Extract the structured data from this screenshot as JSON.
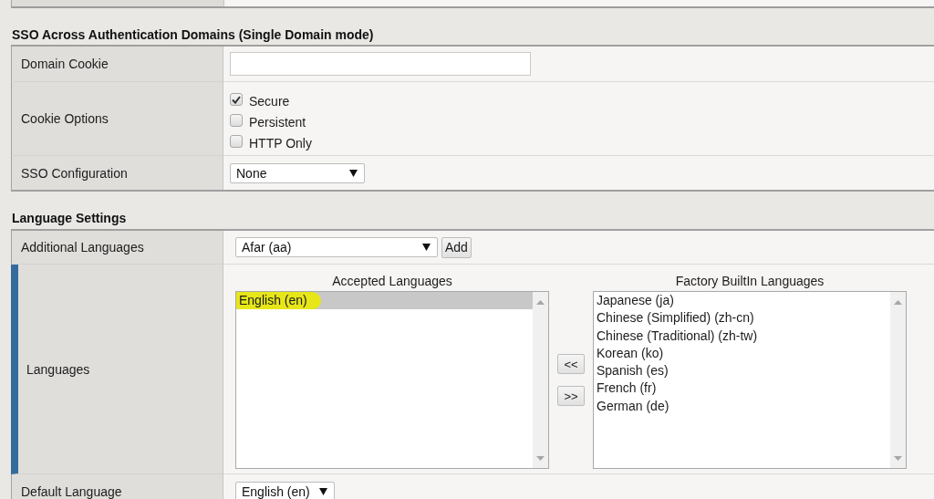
{
  "sections": [
    {
      "title": "SSO Across Authentication Domains (Single Domain mode)",
      "rows": [
        {
          "kind": "input",
          "label": "Domain Cookie",
          "active": false
        },
        {
          "kind": "checkboxes",
          "label": "Cookie Options",
          "active": false,
          "options": [
            {
              "label": "Secure",
              "checked": true
            },
            {
              "label": "Persistent",
              "checked": false
            },
            {
              "label": "HTTP Only",
              "checked": false
            }
          ]
        },
        {
          "kind": "select",
          "label": "SSO Configuration",
          "active": false,
          "value": "None"
        }
      ]
    },
    {
      "title": "Language Settings",
      "rows": [
        {
          "kind": "select_add",
          "label": "Additional Languages",
          "active": false,
          "value": "Afar (aa)",
          "button": "Add"
        },
        {
          "kind": "lists",
          "label": "Languages",
          "active": true,
          "accepted": {
            "title": "Accepted Languages",
            "items": [
              {
                "label": "English (en)",
                "selected": true,
                "highlighted": true
              }
            ]
          },
          "buttons": [
            "<<",
            ">>"
          ],
          "factory": {
            "title": "Factory BuiltIn Languages",
            "items": [
              {
                "label": "Japanese (ja)",
                "selected": false,
                "highlighted": false
              },
              {
                "label": "Chinese (Simplified) (zh-cn)",
                "selected": false,
                "highlighted": false
              },
              {
                "label": "Chinese (Traditional) (zh-tw)",
                "selected": false,
                "highlighted": false
              },
              {
                "label": "Korean (ko)",
                "selected": false,
                "highlighted": false
              },
              {
                "label": "Spanish (es)",
                "selected": false,
                "highlighted": false
              },
              {
                "label": "French (fr)",
                "selected": false,
                "highlighted": false
              },
              {
                "label": "German (de)",
                "selected": false,
                "highlighted": false
              }
            ]
          }
        },
        {
          "kind": "select",
          "label": "Default Language",
          "active": false,
          "value": "English (en)"
        }
      ]
    }
  ]
}
